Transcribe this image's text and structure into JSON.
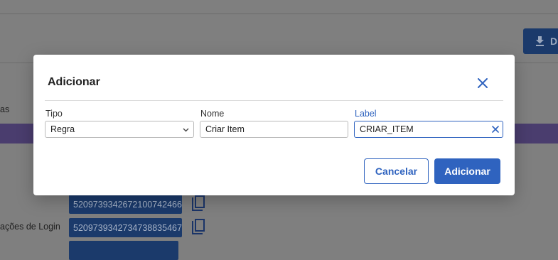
{
  "background": {
    "download_button_label": "D",
    "sidebar_text_1": "as",
    "sidebar_text_2": "ações de Login",
    "ids": [
      "5209739342672100742466",
      "5209739342734738835467"
    ]
  },
  "dialog": {
    "title": "Adicionar",
    "fields": {
      "tipo": {
        "label": "Tipo",
        "value": "Regra"
      },
      "nome": {
        "label": "Nome",
        "value": "Criar Item"
      },
      "label": {
        "label": "Label",
        "value": "CRIAR_ITEM"
      }
    },
    "cancel_label": "Cancelar",
    "submit_label": "Adicionar"
  },
  "colors": {
    "primary": "#2f63bf",
    "overlay": "#7f7f7f"
  }
}
